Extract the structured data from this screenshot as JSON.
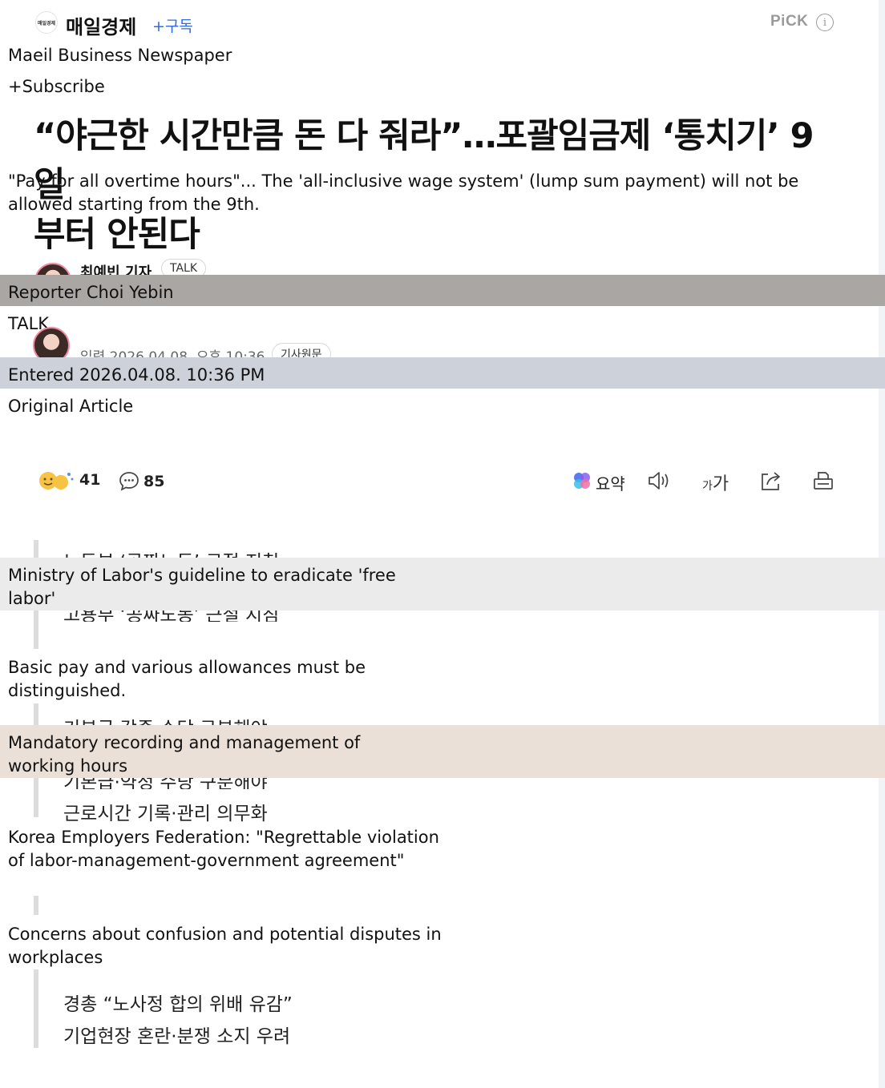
{
  "press": {
    "logo_text": "매일경제",
    "name": "매일경제",
    "subscribe_label": "+구독",
    "pick_label": "PiCK",
    "info_icon": "info-icon",
    "name_en": "Maeil Business Newspaper",
    "subscribe_en": "+Subscribe"
  },
  "headline": {
    "text_kr_line1": "“야근한 시간만큼 돈 다 줘라”…포괄임금제 ‘통치기’ 9일",
    "text_kr_line2": "부터 안된다",
    "text_en": "\"Pay for all overtime hours\"... The 'all-inclusive wage system' (lump sum payment) will not be allowed starting from the 9th."
  },
  "reporter": {
    "name_kr": "최예빈 기자",
    "talk_label": "TALK",
    "name_en": "Reporter Choi Yebin",
    "talk_en": "TALK",
    "date_kr": "입력 2026.04.08. 오후 10:36",
    "original_kr": "기사원문",
    "date_en": "Entered 2026.04.08. 10:36 PM",
    "original_en": "Original Article"
  },
  "toolbar": {
    "reaction_count": "41",
    "comment_count": "85",
    "summary_label": "요약",
    "font_size_label_small": "가",
    "font_size_label_large": "가"
  },
  "summary": {
    "item1_kr_a": "노동부 ‘공짜노동’ 근절 지침",
    "item1_kr_b": "고용부 ‘공짜노동’ 근절 지침",
    "item1_en": "Ministry of Labor's guideline to eradicate 'free labor'",
    "item2_en": "Basic pay and various allowances must be distinguished.",
    "item2_kr": "기본급·각종 수당 구분해야",
    "item3_en": "Mandatory recording and management of working hours",
    "item3_kr_hidden": "기본급·약정 수당 구분해야",
    "item3_kr": "근로시간 기록·관리 의무화",
    "item4_en": "Korea Employers Federation: \"Regrettable violation of labor-management-government agreement\"",
    "item5_en": "Concerns about confusion and potential disputes in workplaces",
    "item4_kr": "경총 “노사정 합의 위배 유감”",
    "item5_kr": "기업현장 혼란·분쟁 소지 우려"
  }
}
